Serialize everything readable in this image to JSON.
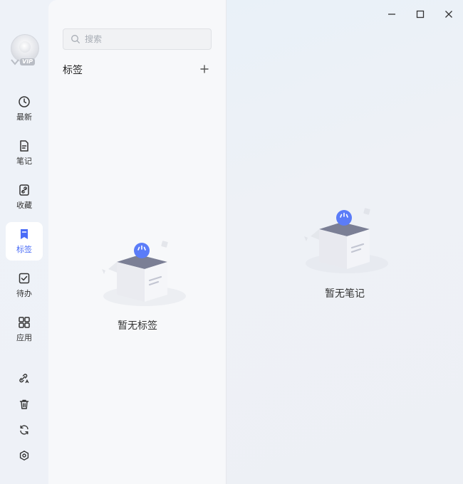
{
  "sidebar": {
    "vip_badge": "VIP",
    "nav": [
      {
        "label": "最新",
        "icon": "clock-icon"
      },
      {
        "label": "笔记",
        "icon": "note-icon"
      },
      {
        "label": "收藏",
        "icon": "link-icon"
      },
      {
        "label": "标签",
        "icon": "bookmark-icon",
        "active": true
      },
      {
        "label": "待办",
        "icon": "checkbox-icon"
      },
      {
        "label": "应用",
        "icon": "apps-grid-icon"
      }
    ],
    "tools": [
      "link-edit-icon",
      "trash-icon",
      "sync-icon",
      "settings-icon"
    ]
  },
  "middle": {
    "search_placeholder": "搜索",
    "section_title": "标签",
    "empty_text": "暂无标签"
  },
  "main": {
    "empty_text": "暂无笔记"
  },
  "window": {
    "controls": [
      "minimize-icon",
      "maximize-icon",
      "close-icon"
    ]
  },
  "colors": {
    "accent": "#4a6cf7",
    "icon": "#333333",
    "badge_grey": "#b9bdc5"
  }
}
